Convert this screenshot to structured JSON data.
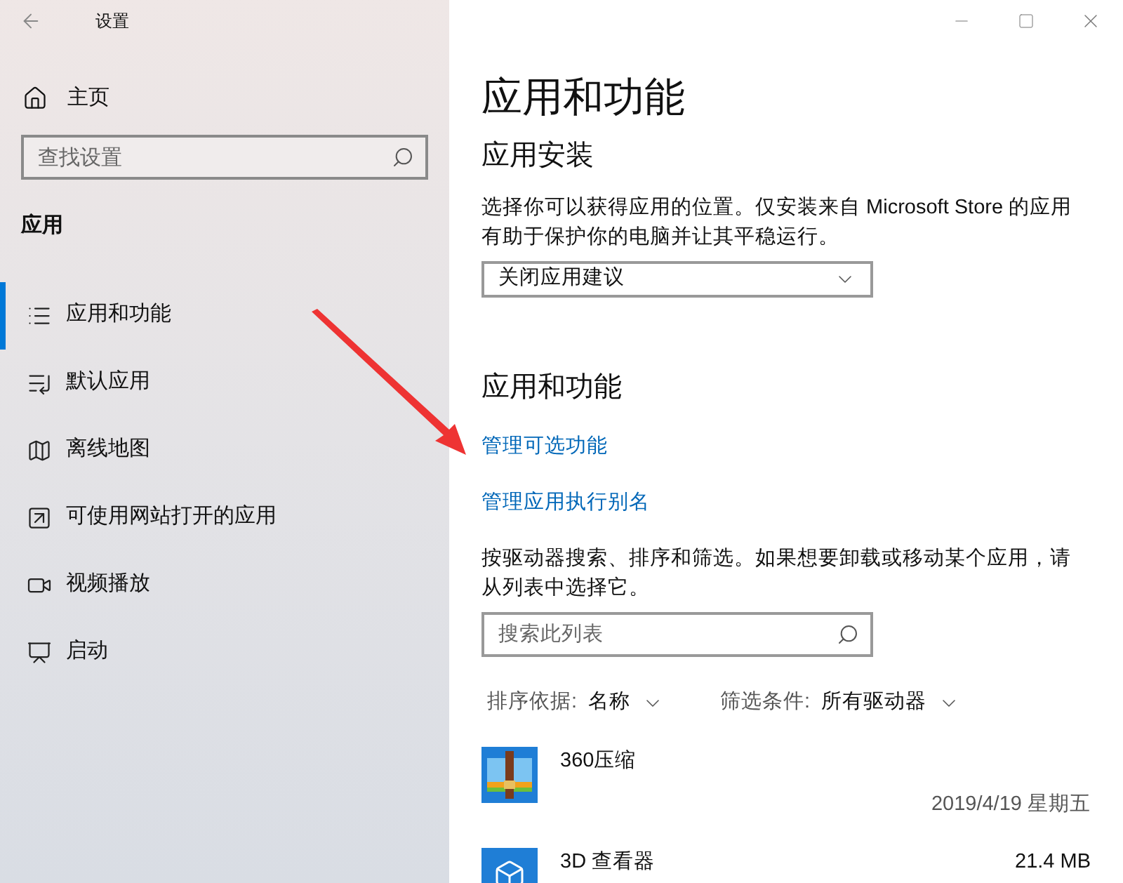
{
  "window": {
    "title": "设置"
  },
  "sidebar": {
    "home": "主页",
    "search": {
      "placeholder": "查找设置"
    },
    "section": "应用",
    "items": [
      {
        "label": "应用和功能",
        "selected": true,
        "kind": "list"
      },
      {
        "label": "默认应用",
        "selected": false,
        "kind": "defaults"
      },
      {
        "label": "离线地图",
        "selected": false,
        "kind": "map"
      },
      {
        "label": "可使用网站打开的应用",
        "selected": false,
        "kind": "web"
      },
      {
        "label": "视频播放",
        "selected": false,
        "kind": "video"
      },
      {
        "label": "启动",
        "selected": false,
        "kind": "startup"
      }
    ]
  },
  "main": {
    "title": "应用和功能",
    "install": {
      "heading": "应用安装",
      "description": "选择你可以获得应用的位置。仅安装来自 Microsoft Store 的应用有助于保护你的电脑并让其平稳运行。",
      "dropdown": "关闭应用建议"
    },
    "features": {
      "heading": "应用和功能",
      "links": [
        "管理可选功能",
        "管理应用执行别名"
      ],
      "description": "按驱动器搜索、排序和筛选。如果想要卸载或移动某个应用，请从列表中选择它。",
      "search": {
        "placeholder": "搜索此列表"
      },
      "sort": {
        "label": "排序依据:",
        "value": "名称"
      },
      "filter": {
        "label": "筛选条件:",
        "value": "所有驱动器"
      },
      "apps": [
        {
          "name": "360压缩",
          "date": "2019/4/19 星期五",
          "kind": "archive"
        },
        {
          "name": "3D 查看器",
          "size": "21.4 MB",
          "kind": "viewer"
        }
      ]
    }
  }
}
